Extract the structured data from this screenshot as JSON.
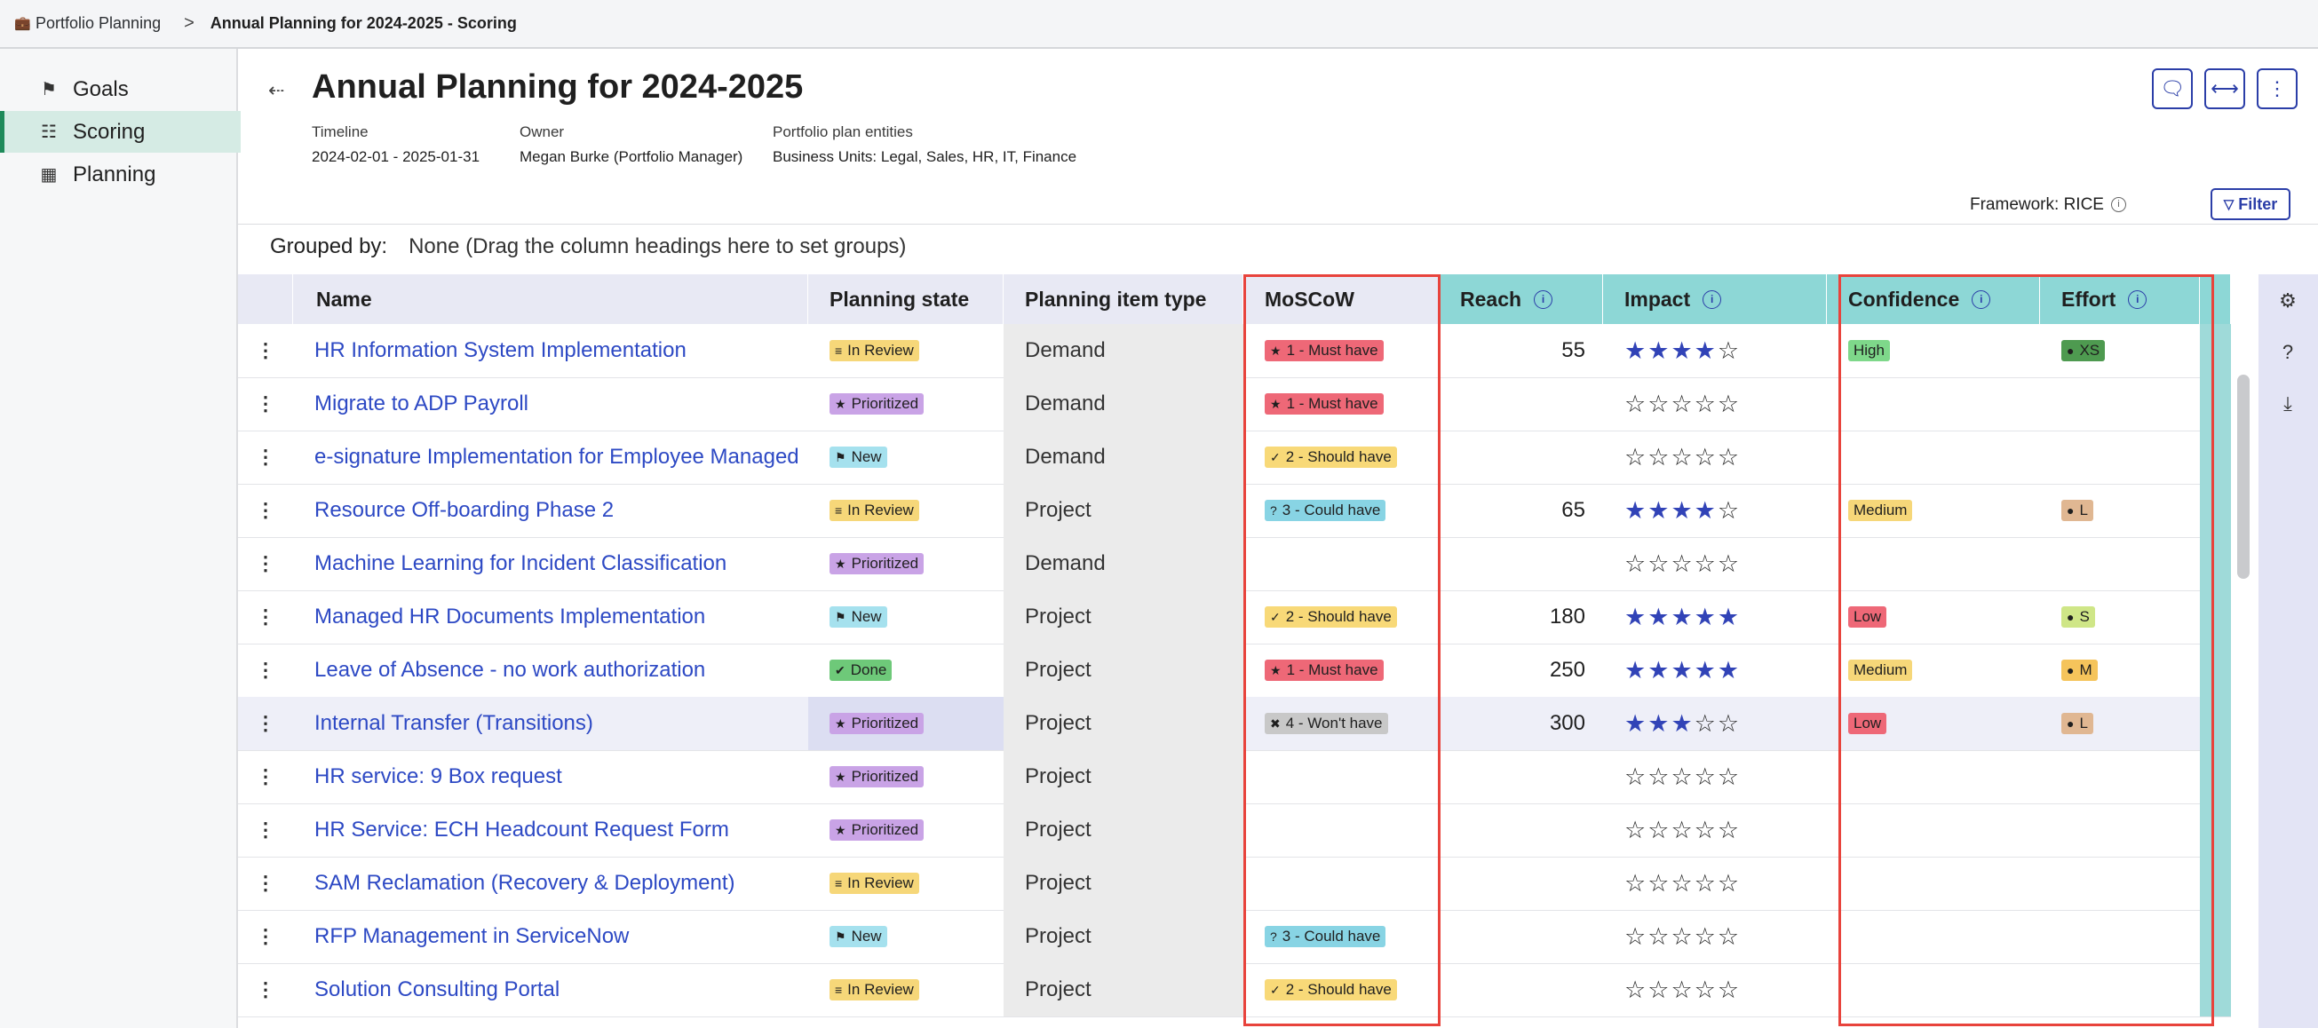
{
  "breadcrumb": {
    "home_icon": "briefcase-icon",
    "items": [
      "Portfolio Planning",
      "Annual Planning for 2024-2025 - Scoring"
    ],
    "separator": ">"
  },
  "sidebar": {
    "items": [
      {
        "label": "Goals",
        "icon": "flag-icon"
      },
      {
        "label": "Scoring",
        "icon": "scoring-icon",
        "active": true
      },
      {
        "label": "Planning",
        "icon": "planning-icon"
      }
    ]
  },
  "header": {
    "title": "Annual Planning for 2024-2025",
    "timeline_label": "Timeline",
    "timeline_value": "2024-02-01 - 2025-01-31",
    "owner_label": "Owner",
    "owner_value": "Megan Burke (Portfolio Manager)",
    "entities_label": "Portfolio plan entities",
    "entities_value": "Business Units: Legal, Sales, HR, IT, Finance",
    "framework": "Framework: RICE",
    "filter_label": "Filter"
  },
  "grouping": {
    "label": "Grouped by:",
    "value": "None (Drag the column headings here to set groups)"
  },
  "columns": {
    "name": "Name",
    "state": "Planning state",
    "type": "Planning item type",
    "moscow": "MoSCoW",
    "reach": "Reach",
    "impact": "Impact",
    "confidence": "Confidence",
    "effort": "Effort"
  },
  "colors": {
    "accent": "#2b3ea8",
    "link": "#2d49c4",
    "highlight_box": "#e8433c",
    "teal_header": "#8dd7d6"
  },
  "rows": [
    {
      "name": "HR Information System Implementation",
      "state": "In Review",
      "type": "Demand",
      "moscow": "1 - Must have",
      "reach": "55",
      "impact": 4,
      "confidence": "High",
      "effort": "XS"
    },
    {
      "name": "Migrate to ADP Payroll",
      "state": "Prioritized",
      "type": "Demand",
      "moscow": "1 - Must have",
      "reach": "",
      "impact": 0,
      "confidence": "",
      "effort": ""
    },
    {
      "name": "e-signature Implementation for Employee Managed",
      "state": "New",
      "type": "Demand",
      "moscow": "2 - Should have",
      "reach": "",
      "impact": 0,
      "confidence": "",
      "effort": ""
    },
    {
      "name": "Resource Off-boarding Phase 2",
      "state": "In Review",
      "type": "Project",
      "moscow": "3 - Could have",
      "reach": "65",
      "impact": 4,
      "confidence": "Medium",
      "effort": "L"
    },
    {
      "name": "Machine Learning for Incident Classification",
      "state": "Prioritized",
      "type": "Demand",
      "moscow": "",
      "reach": "",
      "impact": 0,
      "confidence": "",
      "effort": ""
    },
    {
      "name": "Managed HR Documents Implementation",
      "state": "New",
      "type": "Project",
      "moscow": "2 - Should have",
      "reach": "180",
      "impact": 5,
      "confidence": "Low",
      "effort": "S"
    },
    {
      "name": "Leave of Absence - no work authorization",
      "state": "Done",
      "type": "Project",
      "moscow": "1 - Must have",
      "reach": "250",
      "impact": 5,
      "confidence": "Medium",
      "effort": "M"
    },
    {
      "name": "Internal Transfer (Transitions)",
      "state": "Prioritized",
      "type": "Project",
      "moscow": "4 - Won't have",
      "reach": "300",
      "impact": 3,
      "confidence": "Low",
      "effort": "L",
      "highlighted": true
    },
    {
      "name": "HR service: 9 Box request",
      "state": "Prioritized",
      "type": "Project",
      "moscow": "",
      "reach": "",
      "impact": 0,
      "confidence": "",
      "effort": ""
    },
    {
      "name": "HR Service: ECH Headcount Request Form",
      "state": "Prioritized",
      "type": "Project",
      "moscow": "",
      "reach": "",
      "impact": 0,
      "confidence": "",
      "effort": ""
    },
    {
      "name": "SAM Reclamation (Recovery & Deployment)",
      "state": "In Review",
      "type": "Project",
      "moscow": "",
      "reach": "",
      "impact": 0,
      "confidence": "",
      "effort": ""
    },
    {
      "name": "RFP Management in ServiceNow",
      "state": "New",
      "type": "Project",
      "moscow": "3 - Could have",
      "reach": "",
      "impact": 0,
      "confidence": "",
      "effort": ""
    },
    {
      "name": "Solution Consulting Portal",
      "state": "In Review",
      "type": "Project",
      "moscow": "2 - Should have",
      "reach": "",
      "impact": 0,
      "confidence": "",
      "effort": ""
    }
  ]
}
